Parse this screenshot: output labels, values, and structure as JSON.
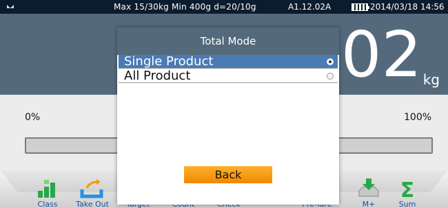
{
  "status": {
    "spec_text": "Max 15/30kg  Min 400g  d=20/10g",
    "version": "A1.12.02A",
    "datetime": "2014/03/18  14:56"
  },
  "weight": {
    "value": "02",
    "unit": "kg"
  },
  "progress": {
    "min_label": "0%",
    "max_label": "100%",
    "fraction": 0
  },
  "dialog": {
    "title": "Total Mode",
    "options": [
      {
        "label": "Single Product",
        "selected": true
      },
      {
        "label": "All Product",
        "selected": false
      }
    ],
    "back_label": "Back"
  },
  "toolbar": {
    "items": [
      {
        "label": "Class",
        "icon": "class-icon"
      },
      {
        "label": "Take Out",
        "icon": "take-out-icon"
      },
      {
        "label": "Target",
        "icon": "target-icon"
      },
      {
        "label": "Count",
        "icon": "count-icon"
      },
      {
        "label": "Check",
        "icon": "check-icon"
      },
      {
        "label": "Pre-Tare",
        "icon": "pre-tare-icon"
      },
      {
        "label": "M+",
        "icon": "m-plus-icon"
      },
      {
        "label": "Sum",
        "icon": "sum-icon"
      }
    ]
  },
  "colors": {
    "header_bg": "#546a7c",
    "selected_bg": "#4a7bb4",
    "button_orange": "#f08800",
    "label_blue": "#1a4fa0"
  }
}
